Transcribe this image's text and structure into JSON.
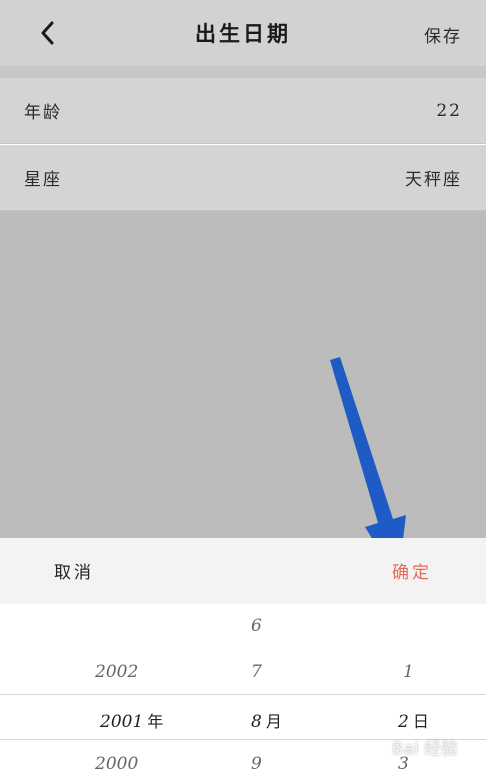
{
  "header": {
    "title": "出生日期",
    "save_label": "保存"
  },
  "rows": [
    {
      "label": "年龄",
      "value": "22"
    },
    {
      "label": "星座",
      "value": "天秤座"
    }
  ],
  "picker": {
    "cancel_label": "取消",
    "confirm_label": "确定",
    "year_column": {
      "above": "2002",
      "selected": "2001",
      "below": "2000",
      "unit": "年"
    },
    "month_column": {
      "above2": "6",
      "above": "7",
      "selected": "8",
      "below": "9",
      "unit": "月"
    },
    "day_column": {
      "above": "1",
      "selected": "2",
      "below": "3",
      "unit": "日"
    }
  },
  "colors": {
    "confirm": "#e26a5a",
    "arrow": "#1f5bc4"
  },
  "watermark": "Bai 经验"
}
